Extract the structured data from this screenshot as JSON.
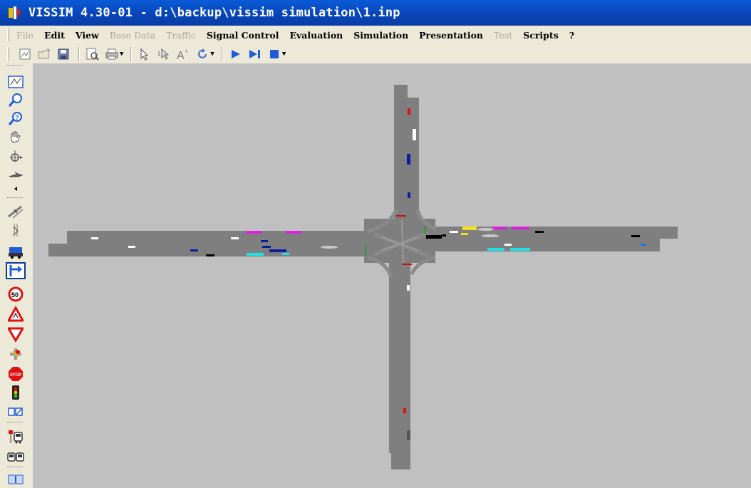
{
  "window": {
    "title": "VISSIM 4.30-01 - d:\\backup\\vissim simulation\\1.inp"
  },
  "menu": {
    "items": [
      {
        "label": "File",
        "enabled": false
      },
      {
        "label": "Edit",
        "enabled": true
      },
      {
        "label": "View",
        "enabled": true
      },
      {
        "label": "Base Data",
        "enabled": false
      },
      {
        "label": "Traffic",
        "enabled": false
      },
      {
        "label": "Signal Control",
        "enabled": true
      },
      {
        "label": "Evaluation",
        "enabled": true
      },
      {
        "label": "Simulation",
        "enabled": true
      },
      {
        "label": "Presentation",
        "enabled": true
      },
      {
        "label": "Test",
        "enabled": false
      },
      {
        "label": "Scripts",
        "enabled": true
      },
      {
        "label": "?",
        "enabled": true
      }
    ]
  },
  "toolbar": {
    "buttons": [
      "new-network-icon",
      "open-icon",
      "save-icon",
      "print-preview-icon",
      "print-icon",
      "select-icon",
      "multiselect-icon",
      "font-size-icon",
      "rotate-icon",
      "run-continuous-icon",
      "single-step-icon",
      "stop-icon"
    ]
  },
  "left_toolbar": {
    "buttons": [
      "show-network-icon",
      "zoom-in-icon",
      "zoom-out-icon",
      "pan-hand-icon",
      "rotate-view-icon",
      "previous-view-icon",
      "links-connectors-icon",
      "routes-icon",
      "vehicle-inputs-icon",
      "routing-decisions-icon",
      "speed-limit-icon",
      "reduced-speed-icon",
      "priority-rules-icon",
      "conflict-areas-icon",
      "stop-signs-icon",
      "signal-heads-icon",
      "detectors-icon",
      "transit-stops-icon",
      "transit-lines-icon",
      "nodes-icon"
    ],
    "active": "routing-decisions-icon"
  },
  "colors": {
    "road": "#7f7f7f",
    "canvas": "#c0c0c0",
    "title_bar": "#0845b8"
  }
}
